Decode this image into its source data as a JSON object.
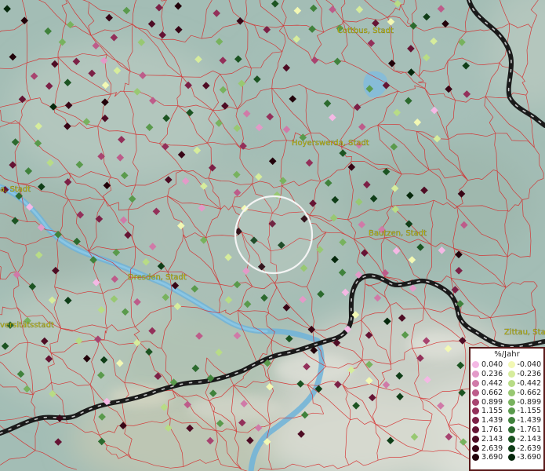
{
  "map": {
    "city_labels": [
      {
        "text": "Cottbus, Stadt"
      },
      {
        "text": "Hoyerswerda, Stadt"
      },
      {
        "text": "a, Stadt"
      },
      {
        "text": "Bautzen, Stadt"
      },
      {
        "text": "Dresden, Stadt"
      },
      {
        "text": "versitätsstadt"
      },
      {
        "text": "Zittau, Stadt"
      }
    ]
  },
  "legend": {
    "title": "%/Jahr",
    "positive": [
      {
        "label": "0.040",
        "color": "#f4b8e4"
      },
      {
        "label": "0.236",
        "color": "#e39ac8"
      },
      {
        "label": "0.442",
        "color": "#d07aa8"
      },
      {
        "label": "0.662",
        "color": "#bd5c8a"
      },
      {
        "label": "0.899",
        "color": "#a84470"
      },
      {
        "label": "1.155",
        "color": "#93305a"
      },
      {
        "label": "1.439",
        "color": "#7c2046"
      },
      {
        "label": "1.761",
        "color": "#651434"
      },
      {
        "label": "2.143",
        "color": "#4e0c24"
      },
      {
        "label": "2.639",
        "color": "#380616"
      },
      {
        "label": "3.690",
        "color": "#22020a"
      }
    ],
    "negative": [
      {
        "label": "-0.040",
        "color": "#f2f8b4"
      },
      {
        "label": "-0.236",
        "color": "#d6ec9c"
      },
      {
        "label": "-0.442",
        "color": "#b8dc86"
      },
      {
        "label": "-0.662",
        "color": "#98c872"
      },
      {
        "label": "-0.899",
        "color": "#78b25e"
      },
      {
        "label": "-1.155",
        "color": "#5a9a4c"
      },
      {
        "label": "-1.439",
        "color": "#40823c"
      },
      {
        "label": "-1.761",
        "color": "#2c6a2e"
      },
      {
        "label": "-2.143",
        "color": "#1c5422"
      },
      {
        "label": "-2.639",
        "color": "#103e18"
      },
      {
        "label": "-3.690",
        "color": "#06280c"
      }
    ]
  }
}
